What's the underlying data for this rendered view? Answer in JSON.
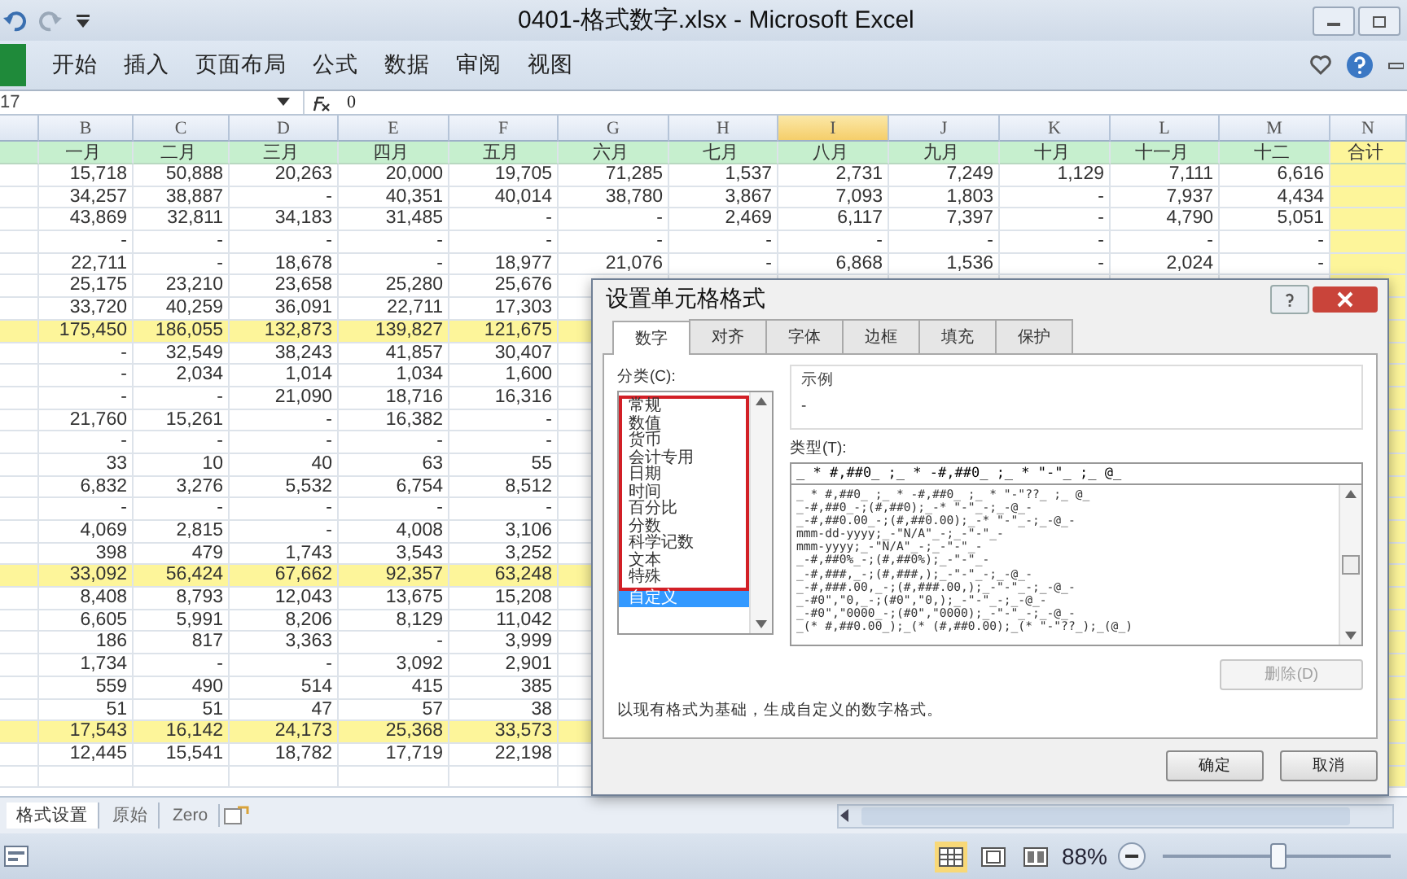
{
  "window": {
    "title": "0401-格式数字.xlsx - Microsoft Excel"
  },
  "ribbon_tabs": [
    {
      "label": "开始",
      "selected": false
    },
    {
      "label": "插入",
      "selected": false
    },
    {
      "label": "页面布局",
      "selected": false
    },
    {
      "label": "公式",
      "selected": false
    },
    {
      "label": "数据",
      "selected": false
    },
    {
      "label": "审阅",
      "selected": false
    },
    {
      "label": "视图",
      "selected": false
    }
  ],
  "formula_bar": {
    "name_box": "17",
    "value": "0"
  },
  "columns": [
    {
      "label": "B",
      "selected": false
    },
    {
      "label": "C",
      "selected": false
    },
    {
      "label": "D",
      "selected": false
    },
    {
      "label": "E",
      "selected": false
    },
    {
      "label": "F",
      "selected": false
    },
    {
      "label": "G",
      "selected": false
    },
    {
      "label": "H",
      "selected": false
    },
    {
      "label": "I",
      "selected": true
    },
    {
      "label": "J",
      "selected": false
    },
    {
      "label": "K",
      "selected": false
    },
    {
      "label": "L",
      "selected": false
    },
    {
      "label": "M",
      "selected": false
    },
    {
      "label": "N",
      "selected": false
    }
  ],
  "header_row": [
    "一月",
    "二月",
    "三月",
    "四月",
    "五月",
    "六月",
    "七月",
    "八月",
    "九月",
    "十月",
    "十一月",
    "十二",
    "合计"
  ],
  "rows": [
    {
      "kind": "data",
      "cells": [
        "15,718",
        "50,888",
        "20,263",
        "20,000",
        "19,705",
        "71,285",
        "1,537",
        "2,731",
        "7,249",
        "1,129",
        "7,111",
        "6,616"
      ]
    },
    {
      "kind": "data",
      "cells": [
        "34,257",
        "38,887",
        "-",
        "40,351",
        "40,014",
        "38,780",
        "3,867",
        "7,093",
        "1,803",
        "-",
        "7,937",
        "4,434"
      ]
    },
    {
      "kind": "data",
      "cells": [
        "43,869",
        "32,811",
        "34,183",
        "31,485",
        "-",
        "-",
        "2,469",
        "6,117",
        "7,397",
        "-",
        "4,790",
        "5,051"
      ]
    },
    {
      "kind": "data",
      "cells": [
        "-",
        "-",
        "-",
        "-",
        "-",
        "-",
        "-",
        "-",
        "-",
        "-",
        "-",
        "-"
      ]
    },
    {
      "kind": "data",
      "cells": [
        "22,711",
        "-",
        "18,678",
        "-",
        "18,977",
        "21,076",
        "-",
        "6,868",
        "1,536",
        "-",
        "2,024",
        "-"
      ]
    },
    {
      "kind": "data",
      "cells": [
        "25,175",
        "23,210",
        "23,658",
        "25,280",
        "25,676"
      ]
    },
    {
      "kind": "data",
      "cells": [
        "33,720",
        "40,259",
        "36,091",
        "22,711",
        "17,303"
      ]
    },
    {
      "kind": "total",
      "cells": [
        "175,450",
        "186,055",
        "132,873",
        "139,827",
        "121,675"
      ]
    },
    {
      "kind": "data",
      "cells": [
        "-",
        "32,549",
        "38,243",
        "41,857",
        "30,407"
      ]
    },
    {
      "kind": "data",
      "cells": [
        "-",
        "2,034",
        "1,014",
        "1,034",
        "1,600"
      ]
    },
    {
      "kind": "data",
      "cells": [
        "-",
        "-",
        "21,090",
        "18,716",
        "16,316"
      ]
    },
    {
      "kind": "data",
      "cells": [
        "21,760",
        "15,261",
        "-",
        "16,382",
        "-"
      ]
    },
    {
      "kind": "data",
      "cells": [
        "-",
        "-",
        "-",
        "-",
        "-"
      ]
    },
    {
      "kind": "data",
      "cells": [
        "33",
        "10",
        "40",
        "63",
        "55"
      ]
    },
    {
      "kind": "data",
      "cells": [
        "6,832",
        "3,276",
        "5,532",
        "6,754",
        "8,512"
      ]
    },
    {
      "kind": "data",
      "cells": [
        "-",
        "-",
        "-",
        "-",
        "-"
      ]
    },
    {
      "kind": "data",
      "cells": [
        "4,069",
        "2,815",
        "-",
        "4,008",
        "3,106"
      ]
    },
    {
      "kind": "data",
      "cells": [
        "398",
        "479",
        "1,743",
        "3,543",
        "3,252"
      ]
    },
    {
      "kind": "total",
      "cells": [
        "33,092",
        "56,424",
        "67,662",
        "92,357",
        "63,248"
      ]
    },
    {
      "kind": "data",
      "cells": [
        "8,408",
        "8,793",
        "12,043",
        "13,675",
        "15,208"
      ]
    },
    {
      "kind": "data",
      "cells": [
        "6,605",
        "5,991",
        "8,206",
        "8,129",
        "11,042"
      ]
    },
    {
      "kind": "data",
      "cells": [
        "186",
        "817",
        "3,363",
        "-",
        "3,999"
      ]
    },
    {
      "kind": "data",
      "cells": [
        "1,734",
        "-",
        "-",
        "3,092",
        "2,901"
      ]
    },
    {
      "kind": "data",
      "cells": [
        "559",
        "490",
        "514",
        "415",
        "385"
      ]
    },
    {
      "kind": "data",
      "cells": [
        "51",
        "51",
        "47",
        "57",
        "38"
      ]
    },
    {
      "kind": "total",
      "cells": [
        "17,543",
        "16,142",
        "24,173",
        "25,368",
        "33,573"
      ]
    },
    {
      "kind": "data",
      "cells": [
        "12,445",
        "15,541",
        "18,782",
        "17,719",
        "22,198"
      ]
    }
  ],
  "sheet_tabs": [
    {
      "label": "格式设置",
      "selected": true
    },
    {
      "label": "原始",
      "selected": false
    },
    {
      "label": "Zero",
      "selected": false
    }
  ],
  "status_bar": {
    "views": [
      {
        "kind": "normal",
        "selected": true
      },
      {
        "kind": "layout",
        "selected": false
      },
      {
        "kind": "pagebreak",
        "selected": false
      }
    ],
    "zoom": "88%",
    "level": 0.5
  },
  "dialog": {
    "title": "设置单元格格式",
    "tabs": [
      {
        "label": "数字",
        "selected": true
      },
      {
        "label": "对齐",
        "selected": false
      },
      {
        "label": "字体",
        "selected": false
      },
      {
        "label": "边框",
        "selected": false
      },
      {
        "label": "填充",
        "selected": false
      },
      {
        "label": "保护",
        "selected": false
      }
    ],
    "category_label": "分类(C):",
    "categories": [
      {
        "label": "常规",
        "selected": false,
        "highlighted": true
      },
      {
        "label": "数值",
        "selected": false,
        "highlighted": true
      },
      {
        "label": "货币",
        "selected": false,
        "highlighted": true
      },
      {
        "label": "会计专用",
        "selected": false,
        "highlighted": true
      },
      {
        "label": "日期",
        "selected": false,
        "highlighted": true
      },
      {
        "label": "时间",
        "selected": false,
        "highlighted": true
      },
      {
        "label": "百分比",
        "selected": false,
        "highlighted": true
      },
      {
        "label": "分数",
        "selected": false,
        "highlighted": true
      },
      {
        "label": "科学记数",
        "selected": false,
        "highlighted": true
      },
      {
        "label": "文本",
        "selected": false,
        "highlighted": true
      },
      {
        "label": "特殊",
        "selected": false,
        "highlighted": true
      },
      {
        "label": "自定义",
        "selected": true,
        "highlighted": false
      }
    ],
    "sample_label": "示例",
    "sample_value": "-",
    "type_label": "类型(T):",
    "type_value": "_ * #,##0_ ;_ * -#,##0_ ;_ * \"-\"_ ;_ @_",
    "formats": [
      "_ * #,##0_ ;_ * -#,##0_ ;_ * \"-\"??_ ;_ @_",
      "_-#,##0_-;(#,##0);_-* \"-\"_-;_-@_-",
      "_-#,##0.00_-;(#,##0.00);_-* \"-\"_-;_-@_-",
      "mmm-dd-yyyy;_-\"N/A\"_-;_-\"-\"_-",
      "mmm-yyyy;_-\"N/A\"_-;_-\"-\"_-",
      "_-#,##0%_-;(#,##0%);_-\"-\"_-",
      "_-#,###,_-;(#,###,);_-\"-\"_-;_-@_-",
      "_-#,###.00,_-;(#,###.00,);_-\"-\"_-;_-@_-",
      "_-#0\",\"0,_-;(#0\",\"0,);_-\"-\"_-;_-@_-",
      "_-#0\",\"0000_-;(#0\",\"0000);_-\"-\"_-;_-@_-",
      "_(* #,##0.00_);_(* (#,##0.00);_(* \"-\"??_);_(@_)"
    ],
    "delete_button": {
      "label": "删除(D)",
      "disabled": true
    },
    "description": "以现有格式为基础，生成自定义的数字格式。",
    "buttons": [
      "确定",
      "取消"
    ]
  }
}
